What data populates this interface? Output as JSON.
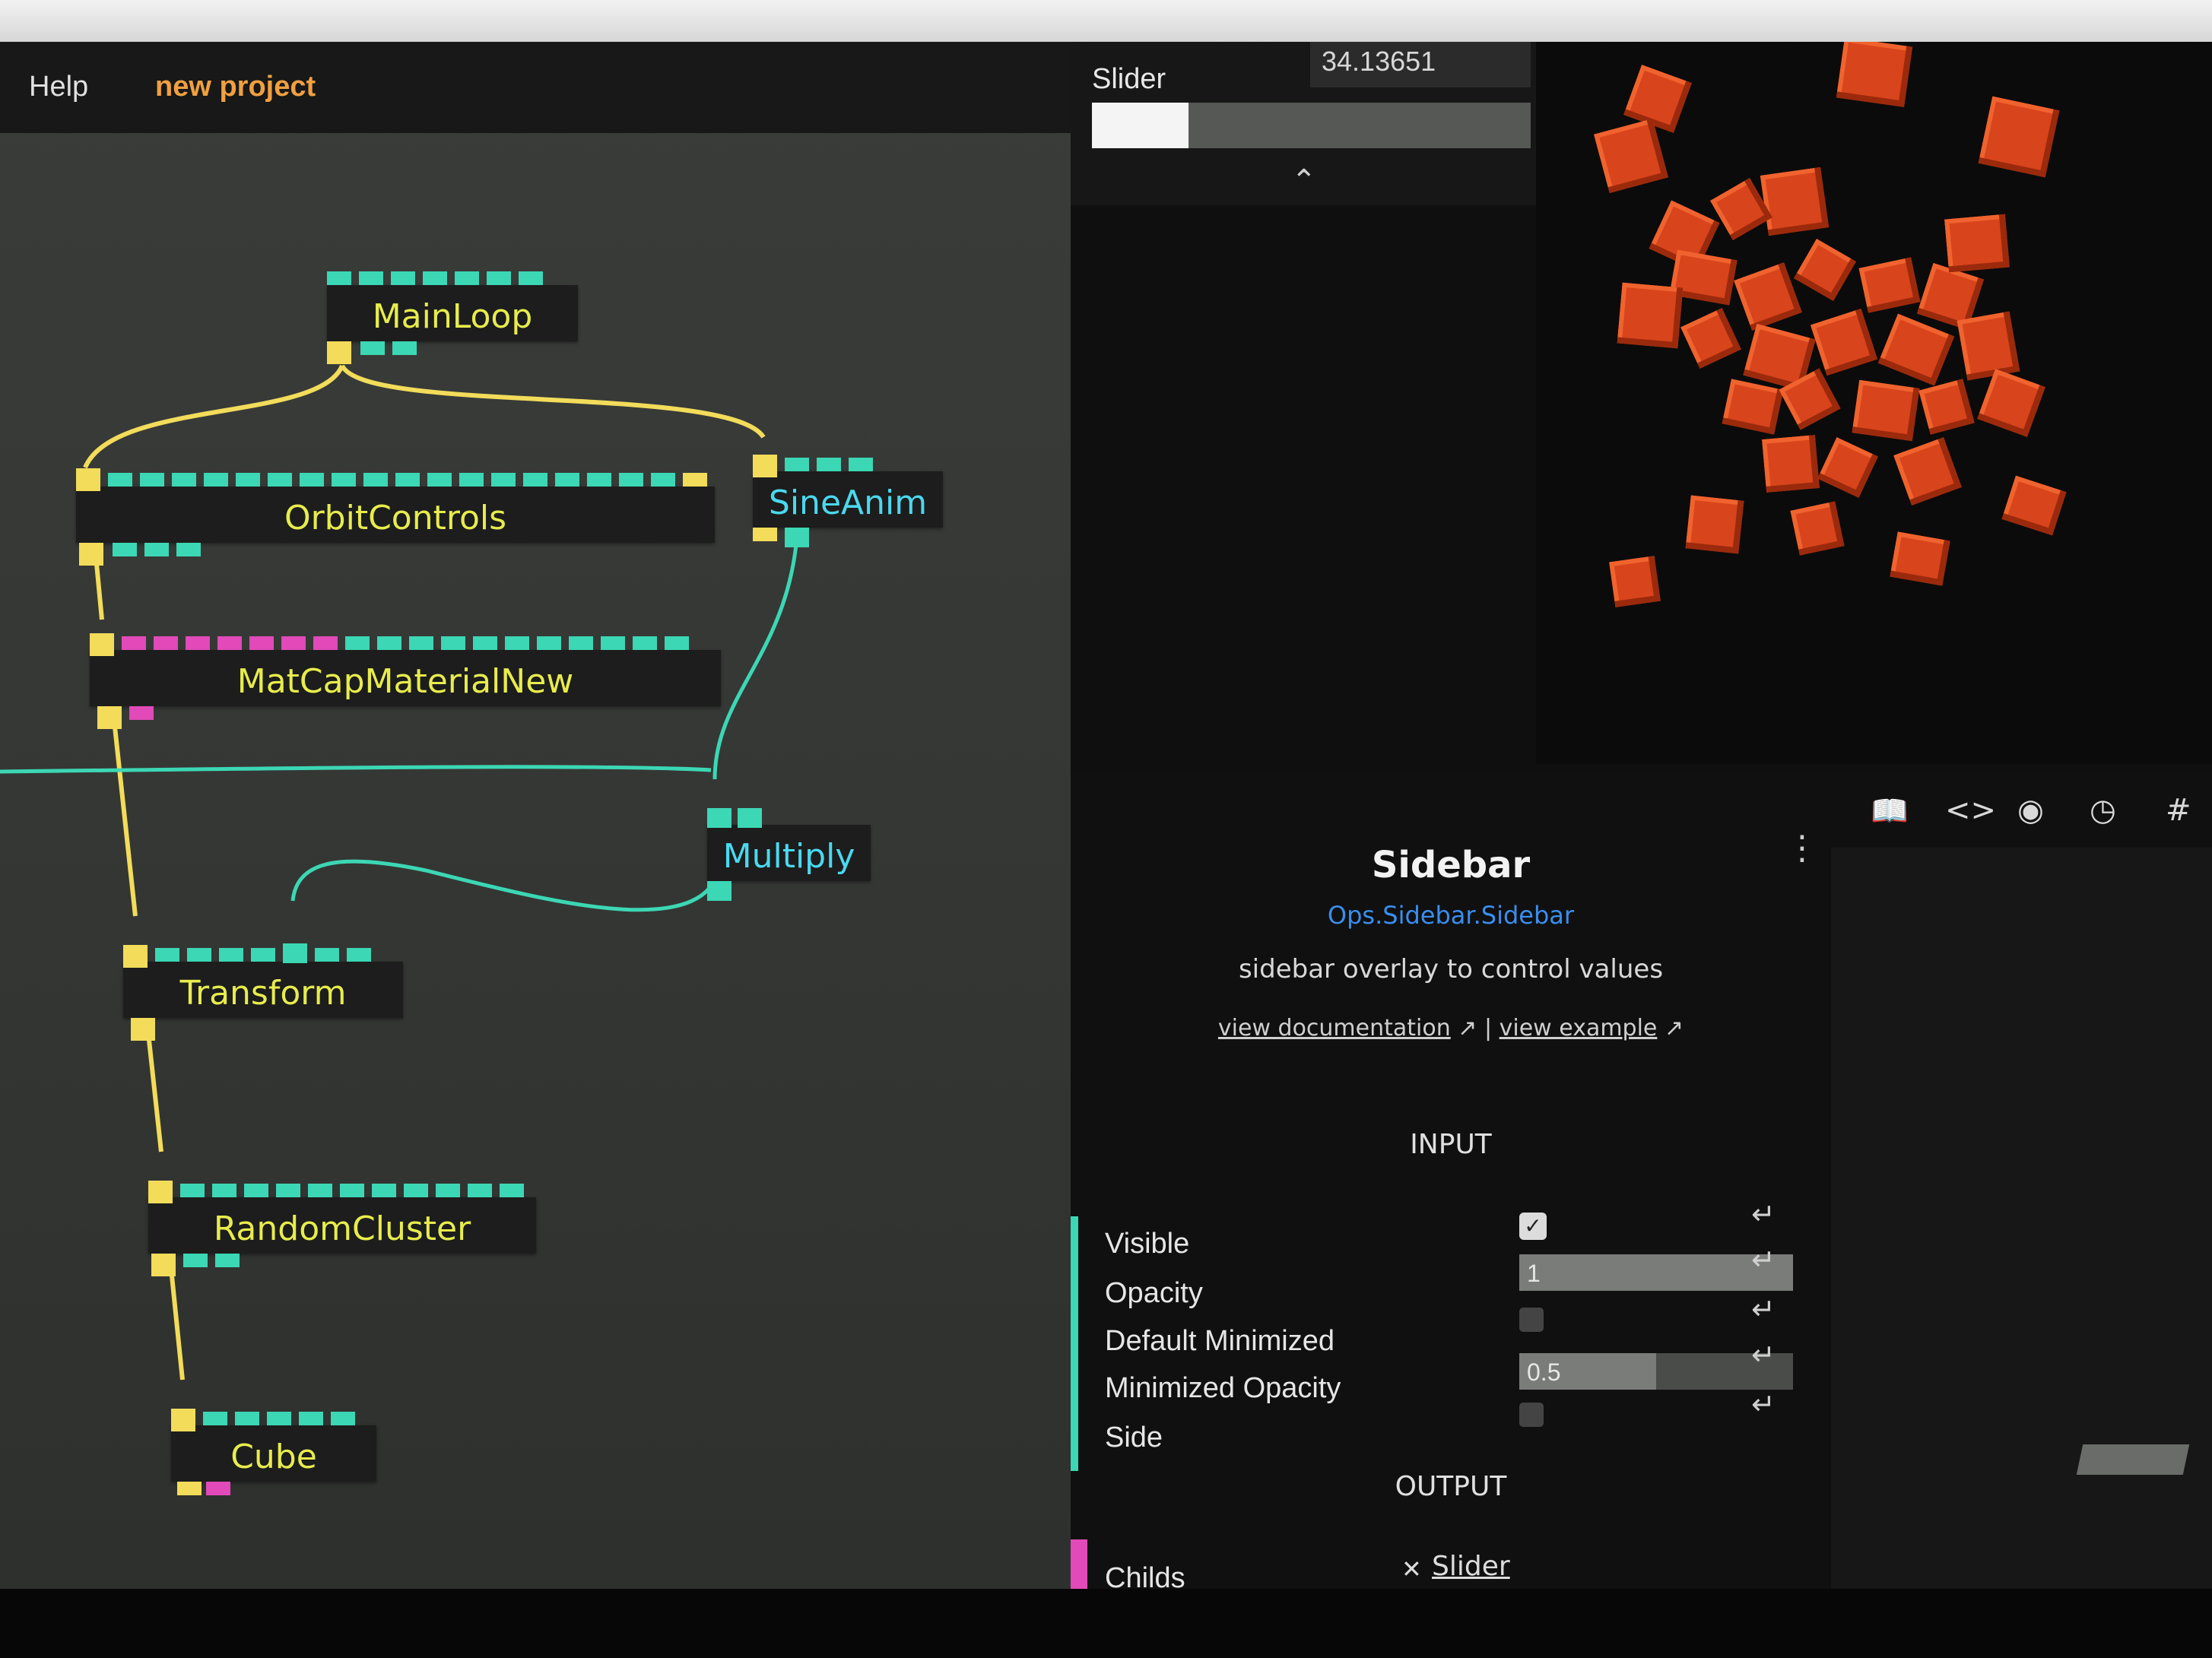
{
  "menu": {
    "help": "Help",
    "project": "new project"
  },
  "nodes": {
    "mainloop": "MainLoop",
    "orbitcontrols": "OrbitControls",
    "sineanim": "SineAnim",
    "matcap": "MatCapMaterialNew",
    "multiply": "Multiply",
    "transform": "Transform",
    "randomcluster": "RandomCluster",
    "cube": "Cube"
  },
  "slider_widget": {
    "label": "Slider",
    "value": "34.13651",
    "fill_fraction": 0.22,
    "collapse_icon": "chevron-up-icon"
  },
  "op_info": {
    "title": "Sidebar",
    "path": "Ops.Sidebar.Sidebar",
    "description": "sidebar overlay to control values",
    "doc_link": "view documentation",
    "example_link": "view example",
    "separator": "|",
    "menu_icon": "kebab-menu-icon"
  },
  "ports": {
    "input_heading": "INPUT",
    "output_heading": "OUTPUT",
    "inputs": [
      {
        "label": "Visible",
        "type": "checkbox",
        "checked": true
      },
      {
        "label": "Opacity",
        "type": "number",
        "value": "1",
        "fill_fraction": 1.0
      },
      {
        "label": "Default Minimized",
        "type": "checkbox",
        "checked": false
      },
      {
        "label": "Minimized Opacity",
        "type": "number",
        "value": "0.5",
        "fill_fraction": 0.5
      },
      {
        "label": "Side",
        "type": "checkbox",
        "checked": false
      }
    ],
    "outputs": [
      {
        "label": "Childs",
        "value": "Slider",
        "remove_icon": "close-icon"
      }
    ]
  },
  "toolbar_icons": [
    "book-icon",
    "code-icon",
    "eye-icon",
    "clock-icon",
    "hash-icon"
  ],
  "colors": {
    "accent_orange": "#f0a040",
    "port_cyan": "#3cd7b4",
    "port_yellow": "#f2dc5a",
    "port_magenta": "#e14ab8",
    "node_title_yellow": "#e8ec4c",
    "node_title_cyan": "#4ad9f0",
    "link_blue": "#3a8ef0",
    "cube_orange": "#d8441c"
  }
}
